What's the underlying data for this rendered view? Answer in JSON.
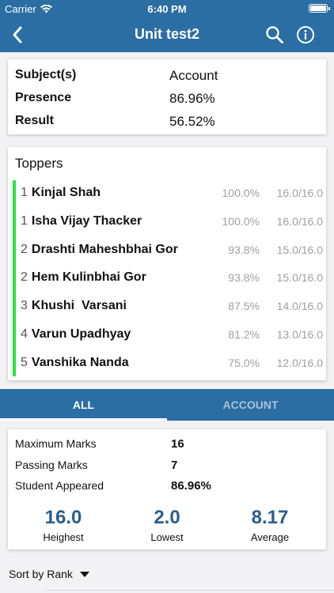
{
  "status_bar": {
    "carrier": "Carrier",
    "time": "6:40 PM",
    "battery_level": 1.0
  },
  "nav": {
    "title": "Unit test2",
    "icons": [
      "back-chevron-icon",
      "search-icon",
      "info-icon"
    ]
  },
  "summary": {
    "rows": [
      {
        "label": "Subject(s)",
        "value": "Account"
      },
      {
        "label": "Presence",
        "value": "86.96%"
      },
      {
        "label": "Result",
        "value": "56.52%"
      }
    ]
  },
  "toppers": {
    "heading": "Toppers",
    "items": [
      {
        "rank": "1",
        "name": "Kinjal Shah",
        "percent": "100.0%",
        "marks": "16.0/16.0"
      },
      {
        "rank": "1",
        "name": "Isha Vijay Thacker",
        "percent": "100.0%",
        "marks": "16.0/16.0"
      },
      {
        "rank": "2",
        "name": "Drashti Maheshbhai Gor",
        "percent": "93.8%",
        "marks": "15.0/16.0"
      },
      {
        "rank": "2",
        "name": "Hem Kulinbhai Gor",
        "percent": "93.8%",
        "marks": "15.0/16.0"
      },
      {
        "rank": "3",
        "name": "Khushi  Varsani",
        "percent": "87.5%",
        "marks": "14.0/16.0"
      },
      {
        "rank": "4",
        "name": "Varun Upadhyay",
        "percent": "81.2%",
        "marks": "13.0/16.0"
      },
      {
        "rank": "5",
        "name": "Vanshika Nanda",
        "percent": "75.0%",
        "marks": "12.0/16.0"
      }
    ]
  },
  "tabs": [
    {
      "label": "ALL",
      "active": true
    },
    {
      "label": "ACCOUNT",
      "active": false
    }
  ],
  "stats": {
    "rows": [
      {
        "label": "Maximum Marks",
        "value": "16"
      },
      {
        "label": "Passing Marks",
        "value": "7"
      },
      {
        "label": "Student Appeared",
        "value": "86.96%"
      }
    ],
    "metrics": [
      {
        "value": "16.0",
        "label": "Heighest"
      },
      {
        "value": "2.0",
        "label": "Lowest"
      },
      {
        "value": "8.17",
        "label": "Average"
      }
    ]
  },
  "sort": {
    "label": "Sort by Rank"
  },
  "colors": {
    "header": "#2b6ea3",
    "accent_bar": "#2ee53f",
    "metric_text": "#2a5f8c"
  }
}
